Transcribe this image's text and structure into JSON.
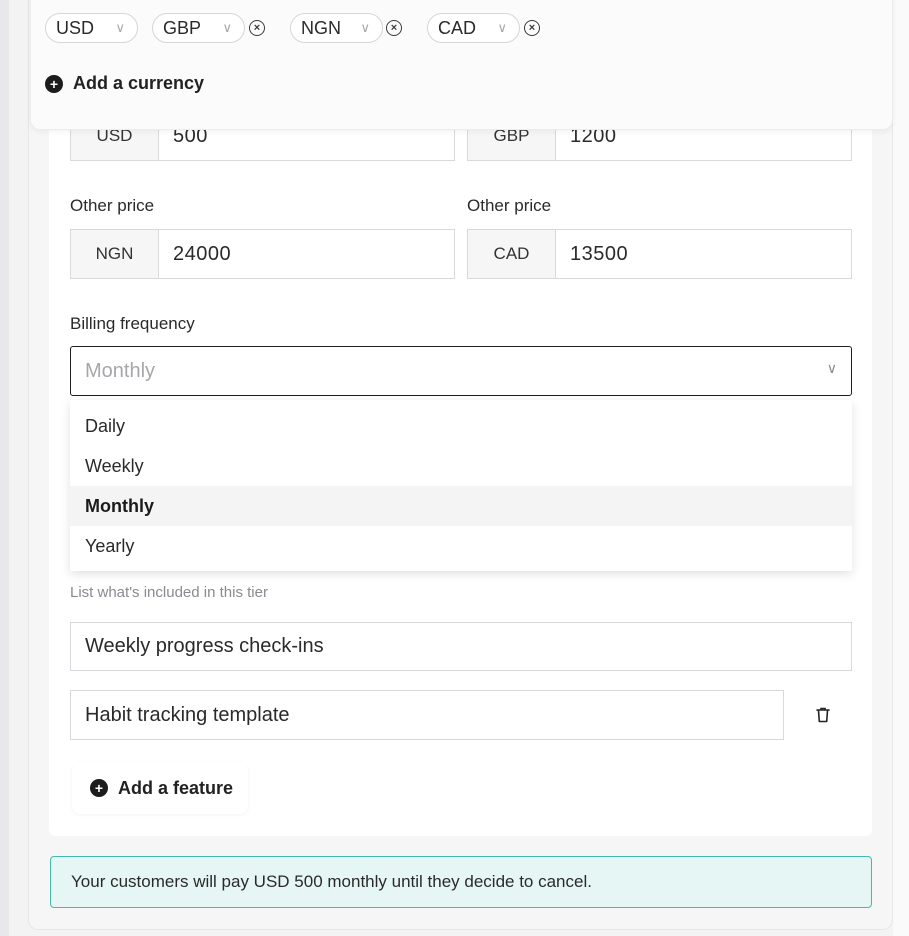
{
  "currency_selector": {
    "chips": [
      {
        "code": "USD",
        "removable": false
      },
      {
        "code": "GBP",
        "removable": true
      },
      {
        "code": "NGN",
        "removable": true
      },
      {
        "code": "CAD",
        "removable": true
      }
    ],
    "add_label": "Add a currency"
  },
  "prices": {
    "primary": [
      {
        "code": "USD",
        "value": "500"
      },
      {
        "code": "GBP",
        "value": "1200"
      }
    ],
    "other_label": "Other price",
    "other": [
      {
        "code": "NGN",
        "value": "24000"
      },
      {
        "code": "CAD",
        "value": "13500"
      }
    ]
  },
  "billing": {
    "label": "Billing frequency",
    "selected": "Monthly",
    "options": [
      "Daily",
      "Weekly",
      "Monthly",
      "Yearly"
    ]
  },
  "features": {
    "hint": "List what's included in this tier",
    "items": [
      "Weekly progress check-ins",
      "Habit tracking template"
    ],
    "add_label": "Add a feature"
  },
  "notice": {
    "text": "Your customers will pay USD 500 monthly until they decide to cancel."
  },
  "colors": {
    "notice_bg": "#e6f6f4",
    "notice_border": "#46b9ad",
    "select_border": "#1e1e1e"
  }
}
